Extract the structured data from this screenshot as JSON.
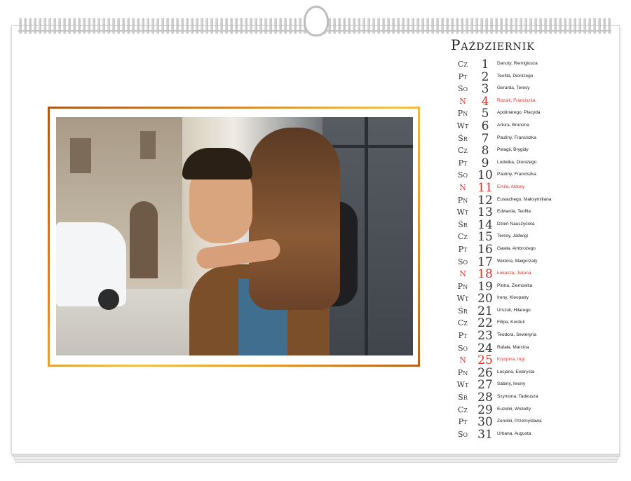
{
  "calendar": {
    "month": "Październik",
    "accent_color": "#e0322b",
    "frame_colors": [
      "#a85a1e",
      "#f1c24b"
    ],
    "days": [
      {
        "dow": "Cz",
        "num": "1",
        "names": "Danuty, Remigiusza",
        "sunday": false
      },
      {
        "dow": "Pt",
        "num": "2",
        "names": "Teofila, Dionizego",
        "sunday": false
      },
      {
        "dow": "So",
        "num": "3",
        "names": "Gerarda, Teresy",
        "sunday": false
      },
      {
        "dow": "N",
        "num": "4",
        "names": "Rozalii, Franciszka",
        "sunday": true
      },
      {
        "dow": "Pn",
        "num": "5",
        "names": "Apolinarego, Placyda",
        "sunday": false
      },
      {
        "dow": "Wt",
        "num": "6",
        "names": "Artura, Brunona",
        "sunday": false
      },
      {
        "dow": "Śr",
        "num": "7",
        "names": "Pauliny, Franciszka",
        "sunday": false
      },
      {
        "dow": "Cz",
        "num": "8",
        "names": "Pelagii, Brygidy",
        "sunday": false
      },
      {
        "dow": "Pt",
        "num": "9",
        "names": "Ludwika, Dionizego",
        "sunday": false
      },
      {
        "dow": "So",
        "num": "10",
        "names": "Pauliny, Franciszka",
        "sunday": false
      },
      {
        "dow": "N",
        "num": "11",
        "names": "Emila, Aldony",
        "sunday": true
      },
      {
        "dow": "Pn",
        "num": "12",
        "names": "Eustachego, Maksymiliana",
        "sunday": false
      },
      {
        "dow": "Wt",
        "num": "13",
        "names": "Edwarda, Teofila",
        "sunday": false
      },
      {
        "dow": "Śr",
        "num": "14",
        "names": "Dzień Nauczyciela",
        "sunday": false
      },
      {
        "dow": "Cz",
        "num": "15",
        "names": "Teresy, Jadwigi",
        "sunday": false
      },
      {
        "dow": "Pt",
        "num": "16",
        "names": "Gawła, Ambrożego",
        "sunday": false
      },
      {
        "dow": "So",
        "num": "17",
        "names": "Wiktora, Małgorzaty",
        "sunday": false
      },
      {
        "dow": "N",
        "num": "18",
        "names": "Łukasza, Juliana",
        "sunday": true
      },
      {
        "dow": "Pn",
        "num": "19",
        "names": "Piotra, Ziemowita",
        "sunday": false
      },
      {
        "dow": "Wt",
        "num": "20",
        "names": "Ireny, Kleopatry",
        "sunday": false
      },
      {
        "dow": "Śr",
        "num": "21",
        "names": "Urszuli, Hilarego",
        "sunday": false
      },
      {
        "dow": "Cz",
        "num": "22",
        "names": "Filipa, Korduli",
        "sunday": false
      },
      {
        "dow": "Pt",
        "num": "23",
        "names": "Teodora, Seweryna",
        "sunday": false
      },
      {
        "dow": "So",
        "num": "24",
        "names": "Rafała, Marcina",
        "sunday": false
      },
      {
        "dow": "N",
        "num": "25",
        "names": "Kryspina, Ingi",
        "sunday": true
      },
      {
        "dow": "Pn",
        "num": "26",
        "names": "Lucjana, Ewarysta",
        "sunday": false
      },
      {
        "dow": "Wt",
        "num": "27",
        "names": "Sabiny, Iwony",
        "sunday": false
      },
      {
        "dow": "Śr",
        "num": "28",
        "names": "Szymona, Tadeusza",
        "sunday": false
      },
      {
        "dow": "Cz",
        "num": "29",
        "names": "Euzebii, Wioletty",
        "sunday": false
      },
      {
        "dow": "Pt",
        "num": "30",
        "names": "Zenobii, Przemysława",
        "sunday": false
      },
      {
        "dow": "So",
        "num": "31",
        "names": "Urbana, Augusta",
        "sunday": false
      }
    ]
  }
}
